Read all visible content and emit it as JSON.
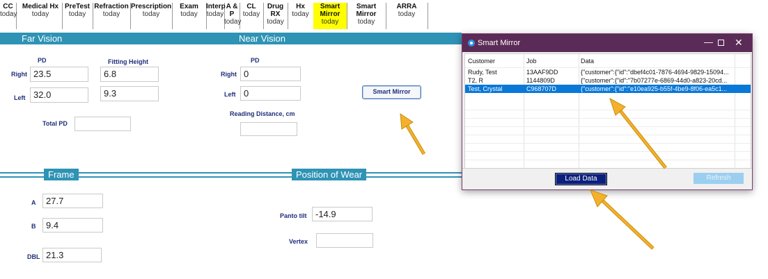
{
  "tabs": [
    {
      "name": "CC",
      "sub": "today"
    },
    {
      "name": "Medical Hx",
      "sub": "today"
    },
    {
      "name": "PreTest",
      "sub": "today"
    },
    {
      "name": "Refraction",
      "sub": "today"
    },
    {
      "name": "Prescription",
      "sub": "today"
    },
    {
      "name": "Exam",
      "sub": "today"
    },
    {
      "name": "Interp",
      "sub": "today"
    },
    {
      "name": "A & P",
      "sub": "today"
    },
    {
      "name": "CL",
      "sub": "today"
    },
    {
      "name": "Drug RX",
      "sub": "today"
    },
    {
      "name": "Hx",
      "sub": "today"
    },
    {
      "name": "Smart Mirror",
      "sub": "today"
    },
    {
      "name": "Smart Mirror",
      "sub": "today"
    },
    {
      "name": "ARRA",
      "sub": "today"
    }
  ],
  "colors": {
    "accent": "#2e93b5",
    "active_tab": "#ffff00",
    "dialog_title": "#5b2b57",
    "selection": "#0a78d7",
    "label": "#1f2f7a",
    "arrow": "#f4b12b"
  },
  "far_vision": {
    "title": "Far Vision",
    "pd_label": "PD",
    "fitting_height_label": "Fitting Height",
    "right_label": "Right",
    "left_label": "Left",
    "right_pd": "23.5",
    "right_fitting_height": "6.8",
    "left_pd": "32.0",
    "left_fitting_height": "9.3",
    "total_pd_label": "Total PD",
    "total_pd": ""
  },
  "near_vision": {
    "title": "Near Vision",
    "pd_label": "PD",
    "right_label": "Right",
    "left_label": "Left",
    "right_pd": "0",
    "left_pd": "0",
    "reading_distance_label": "Reading Distance, cm",
    "reading_distance": "",
    "smart_mirror_button": "Smart Mirror"
  },
  "frame": {
    "title": "Frame",
    "a_label": "A",
    "a": "27.7",
    "b_label": "B",
    "b": "9.4",
    "dbl_label": "DBL",
    "dbl": "21.3"
  },
  "position_of_wear": {
    "title": "Position of Wear",
    "panto_tilt_label": "Panto tilt",
    "panto_tilt": "-14.9",
    "vertex_label": "Vertex",
    "vertex": ""
  },
  "dialog": {
    "title": "Smart Mirror",
    "columns": [
      "Customer",
      "Job",
      "Data"
    ],
    "rows": [
      {
        "customer": "Rudy, Test",
        "job": "13AAF9DD",
        "data": "{\"customer\":{\"id\":\"dbef4c01-7876-4694-9829-15094...",
        "selected": false
      },
      {
        "customer": "T2, R",
        "job": "1144809D",
        "data": "{\"customer\":{\"id\":\"7b07277e-6869-44d0-a823-20cd...",
        "selected": false
      },
      {
        "customer": "Test, Crystal",
        "job": "C968707D",
        "data": "{\"customer\":{\"id\":\"e10ea925-b55f-4be9-8f06-ea5c1...",
        "selected": true
      }
    ],
    "load_button": "Load Data",
    "refresh_button": "Refresh"
  }
}
